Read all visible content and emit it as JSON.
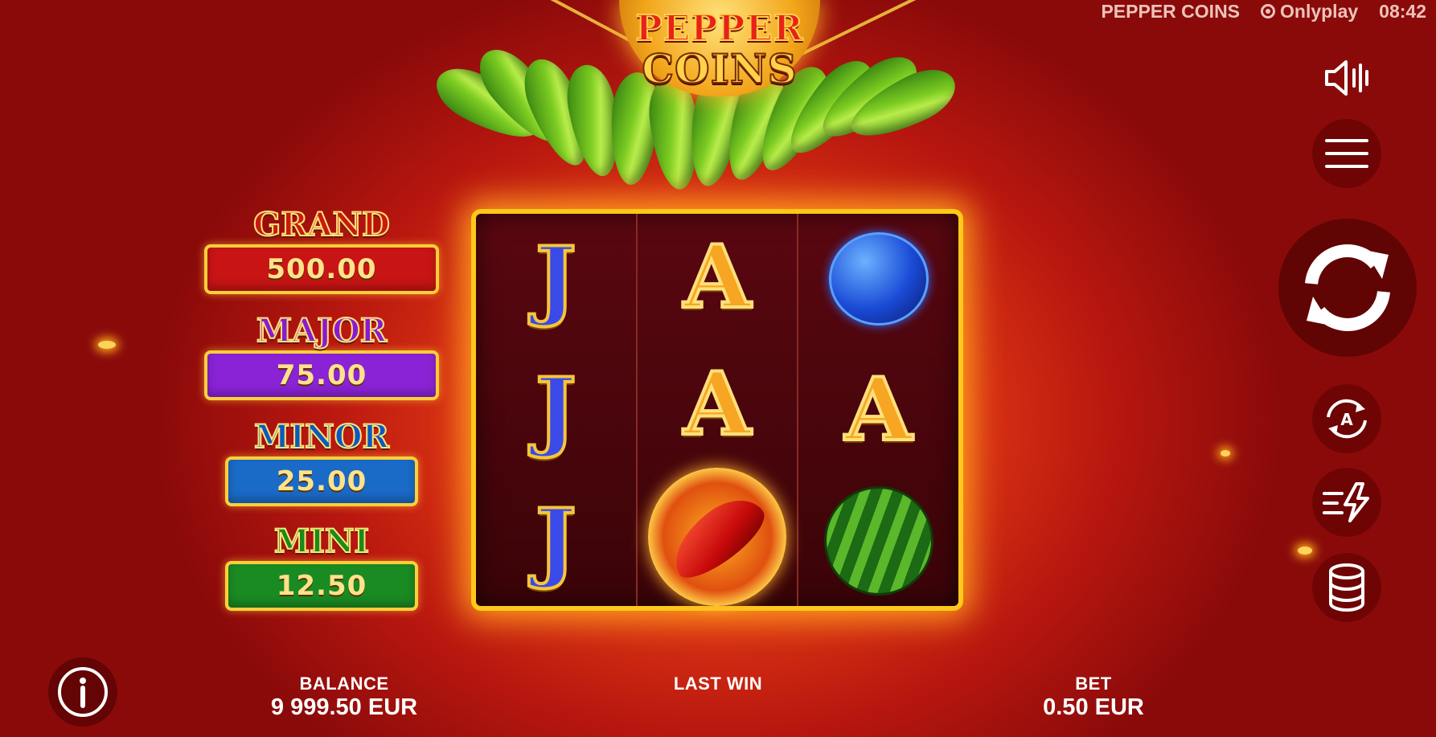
{
  "status_bar": {
    "game_name": "PEPPER COINS",
    "provider": "Onlyplay",
    "time": "08:42"
  },
  "logo": {
    "line1": "PEPPER",
    "line2": "COINS"
  },
  "jackpots": [
    {
      "name": "GRAND",
      "value": "500.00",
      "color": "#c81414",
      "name_color": "#c81a10"
    },
    {
      "name": "MAJOR",
      "value": "75.00",
      "color": "#8a22d6",
      "name_color": "#8a1ad0"
    },
    {
      "name": "MINOR",
      "value": "25.00",
      "color": "#1a6ac8",
      "name_color": "#0a5ac0"
    },
    {
      "name": "MINI",
      "value": "12.50",
      "color": "#1a8a22",
      "name_color": "#1a8a1a"
    }
  ],
  "reels": [
    [
      "J",
      "J",
      "J"
    ],
    [
      "A",
      "A",
      "pepper-coin"
    ],
    [
      "plum",
      "A",
      "watermelon"
    ]
  ],
  "controls": {
    "sound": "sound-icon",
    "menu": "menu-icon",
    "spin": "spin-icon",
    "autoplay": "autoplay-icon",
    "turbo": "turbo-icon",
    "bet": "coins-stack-icon",
    "info": "info-icon"
  },
  "bottom": {
    "balance_label": "BALANCE",
    "balance_value": "9 999.50 EUR",
    "last_win_label": "LAST WIN",
    "last_win_value": "",
    "bet_label": "BET",
    "bet_value": "0.50 EUR"
  }
}
